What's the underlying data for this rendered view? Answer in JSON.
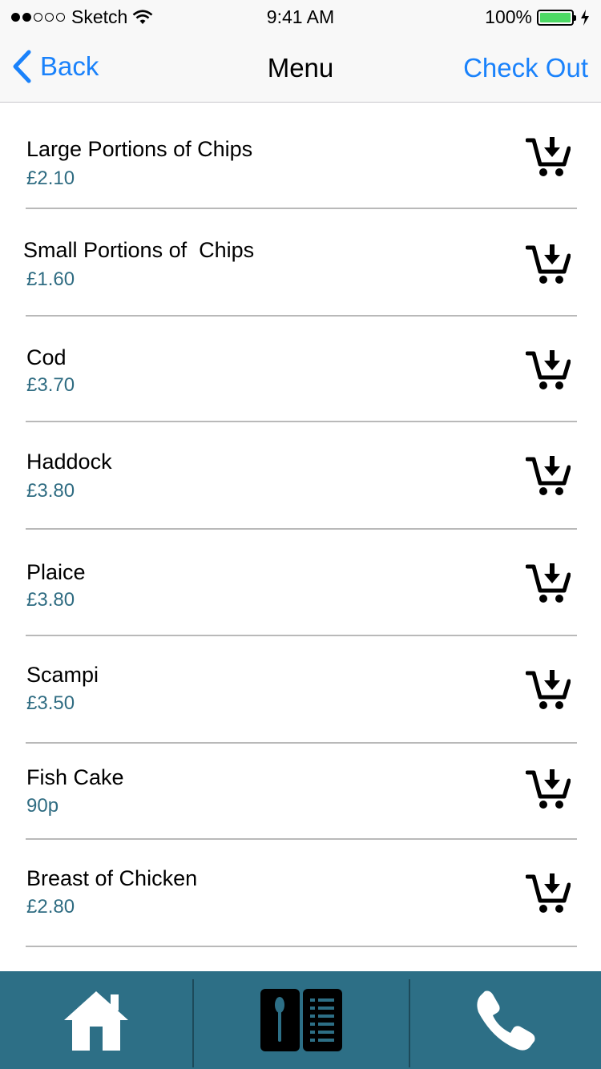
{
  "status_bar": {
    "carrier": "Sketch",
    "time": "9:41 AM",
    "battery": "100%"
  },
  "nav": {
    "back_label": "Back",
    "title": "Menu",
    "checkout_label": "Check Out"
  },
  "menu": {
    "items": [
      {
        "name": "Large Portions of Chips",
        "price": "£2.10"
      },
      {
        "name": "Small Portions of  Chips",
        "price": "£1.60"
      },
      {
        "name": "Cod",
        "price": "£3.70"
      },
      {
        "name": "Haddock",
        "price": "£3.80"
      },
      {
        "name": "Plaice",
        "price": "£3.80"
      },
      {
        "name": "Scampi",
        "price": "£3.50"
      },
      {
        "name": "Fish Cake",
        "price": "90p"
      },
      {
        "name": "Breast of Chicken",
        "price": "£2.80"
      }
    ]
  },
  "tabs": [
    {
      "icon": "home-icon"
    },
    {
      "icon": "menu-book-icon"
    },
    {
      "icon": "phone-icon"
    }
  ],
  "colors": {
    "accent": "#1a82fb",
    "price": "#2f6c82",
    "tab_bar": "#2d6f86",
    "battery": "#4cd964"
  }
}
